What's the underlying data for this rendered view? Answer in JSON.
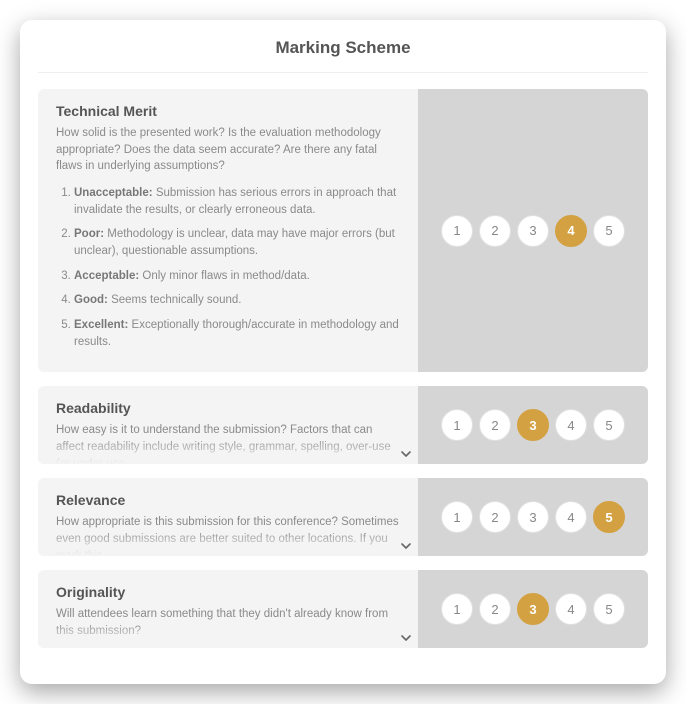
{
  "page_title": "Marking Scheme",
  "scores": [
    "1",
    "2",
    "3",
    "4",
    "5"
  ],
  "criteria": [
    {
      "title": "Technical Merit",
      "description": "How solid is the presented work? Is the evaluation methodology appropriate? Does the data seem accurate? Are there any fatal flaws in underlying assumptions?",
      "expanded": true,
      "selected": 4,
      "scale": [
        {
          "label": "Unacceptable:",
          "text": "Submission has serious errors in approach that invalidate the results, or clearly erroneous data."
        },
        {
          "label": "Poor:",
          "text": "Methodology is unclear, data may have major errors (but unclear), questionable assumptions."
        },
        {
          "label": "Acceptable:",
          "text": "Only minor flaws in method/data."
        },
        {
          "label": "Good:",
          "text": "Seems technically sound."
        },
        {
          "label": "Excellent:",
          "text": "Exceptionally thorough/accurate in methodology and results."
        }
      ]
    },
    {
      "title": "Readability",
      "description": "How easy is it to understand the submission? Factors that can affect readability include writing style, grammar, spelling, over-use (or under-use",
      "expanded": false,
      "selected": 3
    },
    {
      "title": "Relevance",
      "description": "How appropriate is this submission for this conference? Sometimes even good submissions are better suited to other locations. If you mark this",
      "expanded": false,
      "selected": 5
    },
    {
      "title": "Originality",
      "description": "Will attendees learn something that they didn't already know from this submission?",
      "expanded": false,
      "selected": 3
    }
  ]
}
